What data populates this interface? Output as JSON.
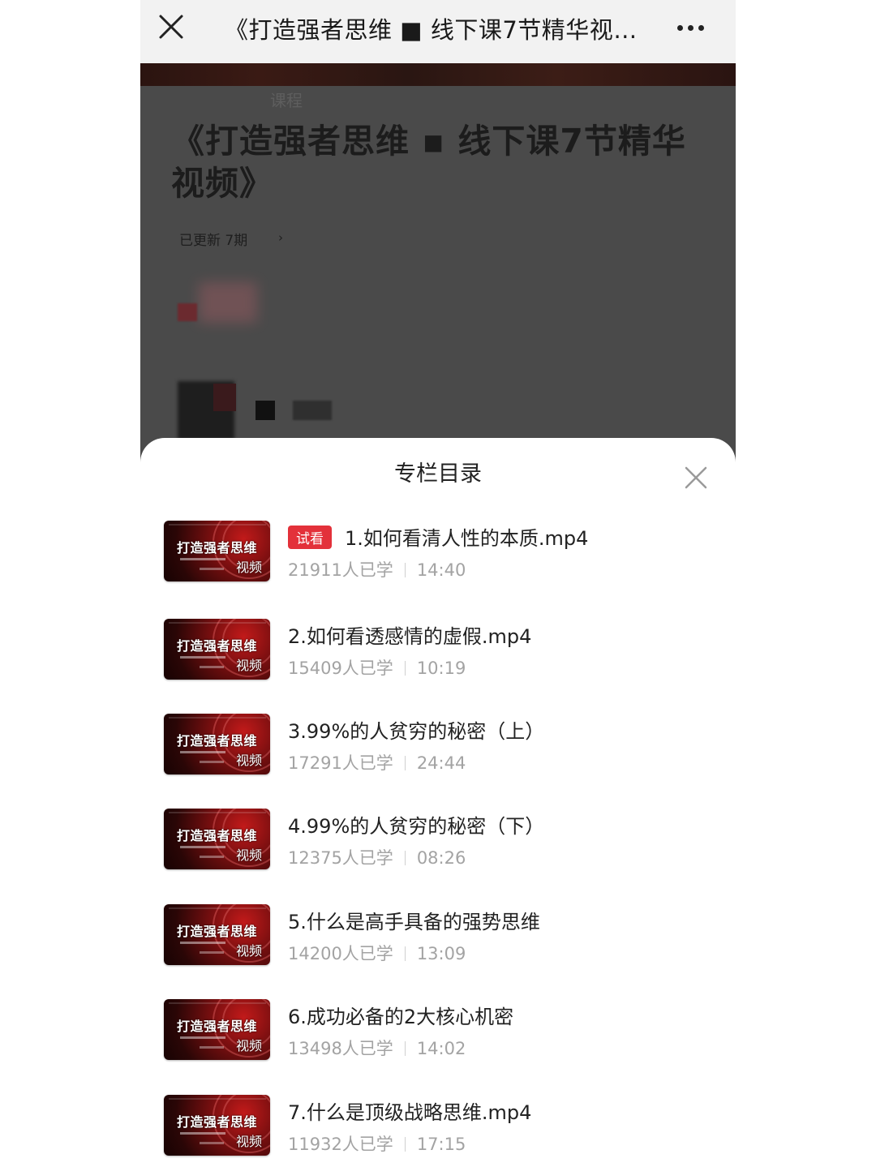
{
  "navbar": {
    "title": "《打造强者思维 ■ 线下课7节精华视频》"
  },
  "header": {
    "tab_label": "课程",
    "course_title": "《打造强者思维 ▪ 线下课7节精华视频》",
    "updated_text": "已更新 7期",
    "arrow": "›"
  },
  "sheet": {
    "title": "专栏目录"
  },
  "thumbnail": {
    "text": "打造强者思维",
    "badge": "视频"
  },
  "lessons": [
    {
      "title": "1.如何看清人性的本质.mp4",
      "trial_label": "试看",
      "learners": "21911人已学",
      "duration": "14:40"
    },
    {
      "title": "2.如何看透感情的虚假.mp4",
      "learners": "15409人已学",
      "duration": "10:19"
    },
    {
      "title": "3.99%的人贫穷的秘密（上）",
      "learners": "17291人已学",
      "duration": "24:44"
    },
    {
      "title": "4.99%的人贫穷的秘密（下）",
      "learners": "12375人已学",
      "duration": "08:26"
    },
    {
      "title": "5.什么是高手具备的强势思维",
      "learners": "14200人已学",
      "duration": "13:09"
    },
    {
      "title": "6.成功必备的2大核心机密",
      "learners": "13498人已学",
      "duration": "14:02"
    },
    {
      "title": "7.什么是顶级战略思维.mp4",
      "learners": "11932人已学",
      "duration": "17:15"
    }
  ],
  "colors": {
    "trial_badge": "#e3313a",
    "meta_text": "#a3a3a3",
    "navbar_bg": "#f2f2f2",
    "overlay_bg": "#4a4a4a"
  }
}
